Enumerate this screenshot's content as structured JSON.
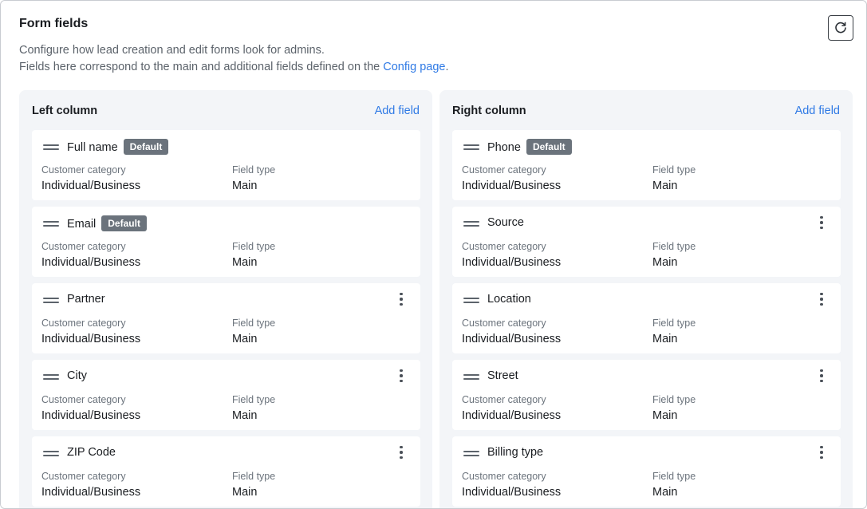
{
  "header": {
    "title": "Form fields",
    "desc_line1": "Configure how lead creation and edit forms look for admins.",
    "desc_line2": "Fields here correspond to the main and additional fields defined on the",
    "config_link": "Config page",
    "desc_end": "."
  },
  "labels": {
    "category": "Customer category",
    "type": "Field type"
  },
  "left": {
    "title": "Left column",
    "add": "Add field",
    "fields": [
      {
        "name": "Full name",
        "badge": "Default",
        "category": "Individual/Business",
        "type": "Main"
      },
      {
        "name": "Email",
        "badge": "Default",
        "category": "Individual/Business",
        "type": "Main"
      },
      {
        "name": "Partner",
        "badge": "",
        "category": "Individual/Business",
        "type": "Main"
      },
      {
        "name": "City",
        "badge": "",
        "category": "Individual/Business",
        "type": "Main"
      },
      {
        "name": "ZIP Code",
        "badge": "",
        "category": "Individual/Business",
        "type": "Main"
      }
    ]
  },
  "right": {
    "title": "Right column",
    "add": "Add field",
    "fields": [
      {
        "name": "Phone",
        "badge": "Default",
        "category": "Individual/Business",
        "type": "Main"
      },
      {
        "name": "Source",
        "badge": "",
        "category": "Individual/Business",
        "type": "Main"
      },
      {
        "name": "Location",
        "badge": "",
        "category": "Individual/Business",
        "type": "Main"
      },
      {
        "name": "Street",
        "badge": "",
        "category": "Individual/Business",
        "type": "Main"
      },
      {
        "name": "Billing type",
        "badge": "",
        "category": "Individual/Business",
        "type": "Main"
      }
    ]
  }
}
